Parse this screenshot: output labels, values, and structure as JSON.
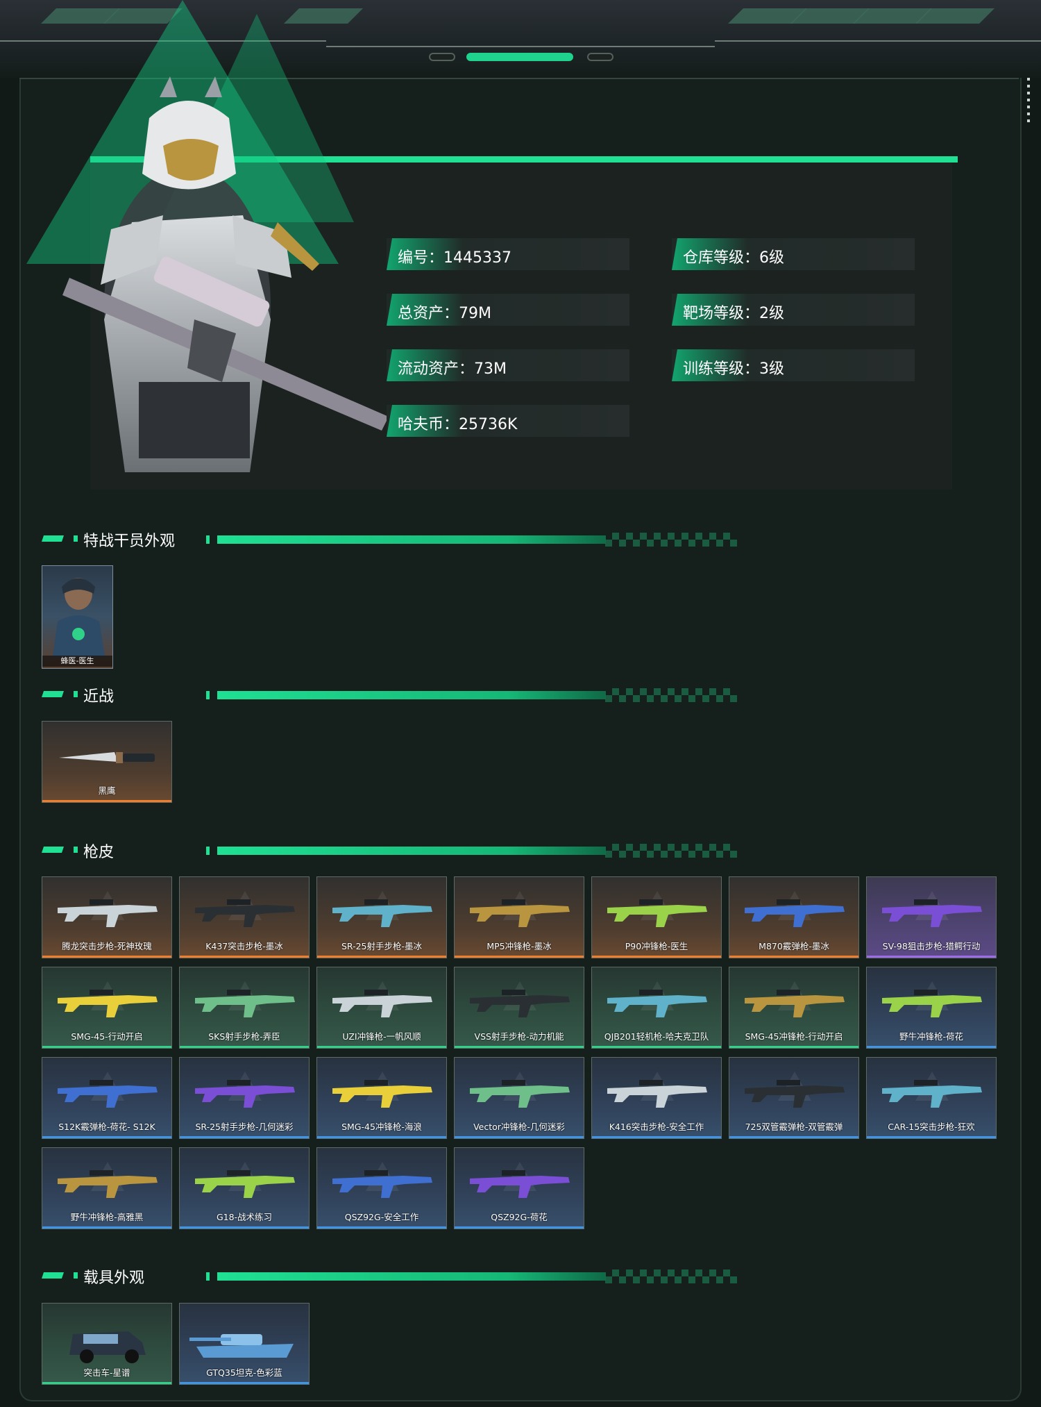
{
  "profile": {
    "stats_left": [
      {
        "label": "编号：1445337"
      },
      {
        "label": "总资产：79M"
      },
      {
        "label": "流动资产：73M"
      },
      {
        "label": "哈夫币：25736K"
      }
    ],
    "stats_right": [
      {
        "label": "仓库等级：6级"
      },
      {
        "label": "靶场等级：2级"
      },
      {
        "label": "训练等级：3级"
      }
    ]
  },
  "sections": {
    "operator": {
      "title": "特战干员外观",
      "items": [
        {
          "label": "蜂医-医生"
        }
      ]
    },
    "melee": {
      "title": "近战",
      "items": [
        {
          "label": "黑鹰"
        }
      ]
    },
    "skins": {
      "title": "枪皮",
      "items": [
        {
          "label": "腾龙突击步枪-死神玫瑰",
          "rarity": "orange"
        },
        {
          "label": "K437突击步枪-墨冰",
          "rarity": "orange"
        },
        {
          "label": "SR-25射手步枪-墨冰",
          "rarity": "orange"
        },
        {
          "label": "MP5冲锋枪-墨冰",
          "rarity": "orange"
        },
        {
          "label": "P90冲锋枪-医生",
          "rarity": "orange"
        },
        {
          "label": "M870霰弹枪-墨冰",
          "rarity": "orange"
        },
        {
          "label": "SV-98狙击步枪-猎鳄行动",
          "rarity": "purple"
        },
        {
          "label": "SMG-45-行动开启",
          "rarity": "green"
        },
        {
          "label": "SKS射手步枪-弄臣",
          "rarity": "green"
        },
        {
          "label": "UZI冲锋枪-一帆风顺",
          "rarity": "green"
        },
        {
          "label": "VSS射手步枪-动力机能",
          "rarity": "green"
        },
        {
          "label": "QJB201轻机枪-哈夫克卫队",
          "rarity": "green"
        },
        {
          "label": "SMG-45冲锋枪-行动开启",
          "rarity": "green"
        },
        {
          "label": "野牛冲锋枪-荷花",
          "rarity": "blue"
        },
        {
          "label": "S12K霰弹枪-荷花- S12K",
          "rarity": "blue"
        },
        {
          "label": "SR-25射手步枪-几何迷彩",
          "rarity": "blue"
        },
        {
          "label": "SMG-45冲锋枪-海浪",
          "rarity": "blue"
        },
        {
          "label": "Vector冲锋枪-几何迷彩",
          "rarity": "blue"
        },
        {
          "label": "K416突击步枪-安全工作",
          "rarity": "blue"
        },
        {
          "label": "725双管霰弹枪-双管霰弹",
          "rarity": "blue"
        },
        {
          "label": "CAR-15突击步枪-狂欢",
          "rarity": "blue"
        },
        {
          "label": "野牛冲锋枪-高雅黑",
          "rarity": "blue"
        },
        {
          "label": "G18-战术练习",
          "rarity": "blue"
        },
        {
          "label": "QSZ92G-安全工作",
          "rarity": "blue"
        },
        {
          "label": "QSZ92G-荷花",
          "rarity": "blue"
        }
      ]
    },
    "vehicles": {
      "title": "载具外观",
      "items": [
        {
          "label": "突击车-星谱",
          "rarity": "green"
        },
        {
          "label": "GTQ35坦克-色彩蓝",
          "rarity": "blue"
        }
      ]
    }
  },
  "icons": {
    "hero": "armored-operator-figure",
    "weapon": "rifle-icon",
    "knife": "knife-icon",
    "vehicle": "vehicle-icon",
    "portrait": "operator-portrait"
  },
  "colors": {
    "accent": "#1fe093",
    "orange": "#ef7f2d",
    "purple": "#9b6bea",
    "green": "#2fd288",
    "blue": "#3f95e8"
  }
}
